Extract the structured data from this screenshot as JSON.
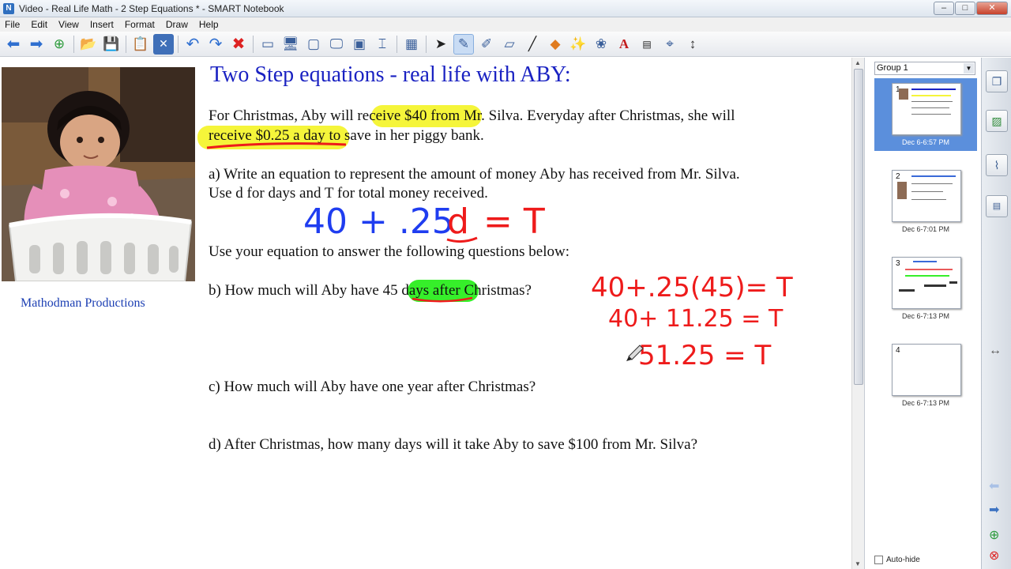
{
  "window": {
    "title": "Video - Real Life Math - 2 Step Equations * - SMART Notebook",
    "minimize": "–",
    "maximize": "□",
    "close": "✕"
  },
  "menu": [
    "File",
    "Edit",
    "View",
    "Insert",
    "Format",
    "Draw",
    "Help"
  ],
  "toolbar": {
    "icons": [
      "back-arrow-icon",
      "forward-arrow-icon",
      "add-page-icon",
      "open-folder-icon",
      "save-icon",
      "paste-icon",
      "delete-page-icon",
      "undo-icon",
      "redo-icon",
      "delete-icon",
      "screen-shade-icon",
      "full-screen-icon",
      "transparent-background-icon",
      "dual-page-icon",
      "screen-capture-icon",
      "document-camera-icon",
      "table-icon",
      "select-icon",
      "pen-icon",
      "creative-pen-icon",
      "eraser-icon",
      "line-icon",
      "shape-icon",
      "magic-pen-icon",
      "fill-icon",
      "text-icon",
      "properties-icon",
      "measurement-tool-icon",
      "move-toolbar-icon"
    ]
  },
  "page": {
    "credit": "Mathodman Productions",
    "heading": "Two Step equations - real life with ABY:",
    "intro_line1": "For Christmas, Aby will receive $40 from Mr. Silva.  Everyday after Christmas, she will",
    "intro_line2": "receive $0.25 a day to save in her piggy bank.",
    "qa_line1": "a)  Write an equation to represent the amount of money Aby has received from Mr. Silva.",
    "qa_line2": "Use d for days and T for total money received.",
    "instruction": "Use your equation to answer the following questions below:",
    "qb": "b)  How much will Aby have 45 days after Christmas?",
    "qc": "c)  How much will Aby have one year after Christmas?",
    "qd": "d)  After Christmas, how many days will it take Aby to save $100 from Mr. Silva?",
    "handwriting": {
      "eq_blue": "40 + .25",
      "eq_d": "d",
      "eq_rest": "= T",
      "b_step1": "40+.25(45)= T",
      "b_step2": "40+ 11.25 = T",
      "b_step3": "51.25 = T"
    },
    "colors": {
      "heading": "#1a22c2",
      "highlight_yellow": "#f5f53a",
      "highlight_green": "#36ef2a",
      "ink_blue": "#1f3df0",
      "ink_red": "#ee1b1b"
    }
  },
  "sidebar": {
    "group": "Group 1",
    "thumbnails": [
      {
        "number": "1",
        "date": "Dec 6-6:57 PM",
        "selected": true
      },
      {
        "number": "2",
        "date": "Dec 6-7:01 PM",
        "selected": false
      },
      {
        "number": "3",
        "date": "Dec 6-7:13 PM",
        "selected": false
      },
      {
        "number": "4",
        "date": "Dec 6-7:13 PM",
        "selected": false
      }
    ],
    "autohide": "Auto-hide"
  },
  "tabs": [
    "page-sorter-icon",
    "gallery-icon",
    "attachments-icon",
    "properties-icon"
  ]
}
